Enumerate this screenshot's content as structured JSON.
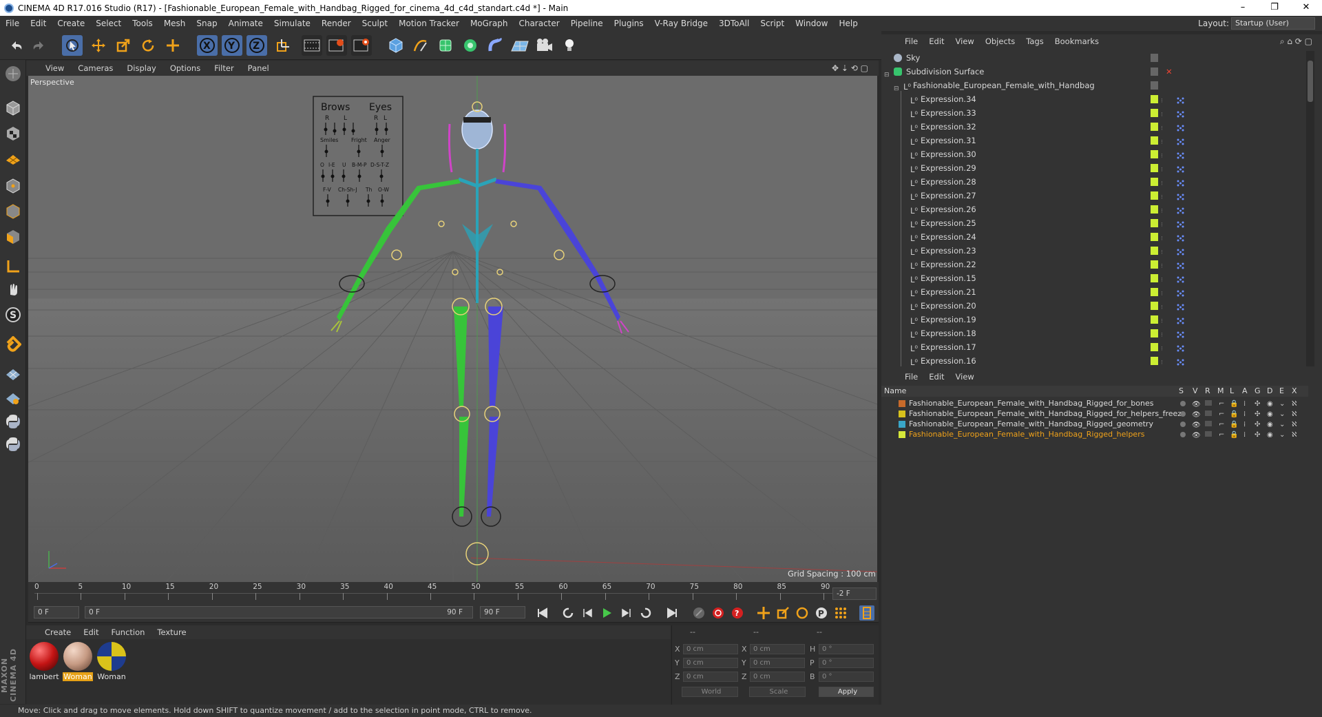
{
  "window": {
    "title": "CINEMA 4D R17.016 Studio (R17) - [Fashionable_European_Female_with_Handbag_Rigged_for_cinema_4d_c4d_standart.c4d *] - Main",
    "minimize": "–",
    "restore": "❐",
    "close": "✕"
  },
  "menubar": [
    "File",
    "Edit",
    "Create",
    "Select",
    "Tools",
    "Mesh",
    "Snap",
    "Animate",
    "Simulate",
    "Render",
    "Sculpt",
    "Motion Tracker",
    "MoGraph",
    "Character",
    "Pipeline",
    "Plugins",
    "V-Ray Bridge",
    "3DToAll",
    "Script",
    "Window",
    "Help"
  ],
  "layout": {
    "label": "Layout:",
    "value": "Startup (User)"
  },
  "viewport": {
    "menu": [
      "View",
      "Cameras",
      "Display",
      "Options",
      "Filter",
      "Panel"
    ],
    "label": "Perspective",
    "grid_spacing": "Grid Spacing : 100 cm",
    "face_panel": {
      "brows": "Brows",
      "eyes": "Eyes",
      "r1": "R",
      "l1": "L",
      "r2": "R",
      "l2": "L",
      "smiles": "Smiles",
      "fright": "Fright",
      "anger": "Anger",
      "vis": [
        "O",
        "I-E",
        "U",
        "B-M-P",
        "D-S-T-Z"
      ],
      "vis2": [
        "F-V",
        "Ch-Sh-J",
        "Th",
        "O-W"
      ]
    }
  },
  "timeline": {
    "ticks": [
      "0",
      "5",
      "10",
      "15",
      "20",
      "25",
      "30",
      "35",
      "40",
      "45",
      "50",
      "55",
      "60",
      "65",
      "70",
      "75",
      "80",
      "85",
      "90"
    ],
    "current_frame_field": "-2 F",
    "start_field": "0 F",
    "range_start": "0 F",
    "range_end": "90 F",
    "end_field": "90 F"
  },
  "materials": {
    "menu": [
      "Create",
      "Edit",
      "Function",
      "Texture"
    ],
    "items": [
      {
        "name": "lambert",
        "color": "#c41414",
        "selected": false
      },
      {
        "name": "Woman",
        "color": "#c69a83",
        "selected": true
      },
      {
        "name": "Woman",
        "color": "#d9c21a",
        "selected": false
      }
    ]
  },
  "coords": {
    "header": [
      "--",
      "--",
      "--"
    ],
    "rows": [
      {
        "a": "X",
        "av": "0 cm",
        "b": "X",
        "bv": "0 cm",
        "c": "H",
        "cv": "0 °"
      },
      {
        "a": "Y",
        "av": "0 cm",
        "b": "Y",
        "bv": "0 cm",
        "c": "P",
        "cv": "0 °"
      },
      {
        "a": "Z",
        "av": "0 cm",
        "b": "Z",
        "bv": "0 cm",
        "c": "B",
        "cv": "0 °"
      }
    ],
    "mode": "World",
    "scale": "Scale",
    "apply": "Apply"
  },
  "status": "Move: Click and drag to move elements. Hold down SHIFT to quantize movement / add to the selection in point mode, CTRL to remove.",
  "object_manager": {
    "menu": [
      "File",
      "Edit",
      "View",
      "Objects",
      "Tags",
      "Bookmarks"
    ],
    "top_items": [
      "Sky",
      "Subdivision Surface",
      "Fashionable_European_Female_with_Handbag"
    ],
    "expressions": [
      "Expression.34",
      "Expression.33",
      "Expression.32",
      "Expression.31",
      "Expression.30",
      "Expression.29",
      "Expression.28",
      "Expression.27",
      "Expression.26",
      "Expression.25",
      "Expression.24",
      "Expression.23",
      "Expression.22",
      "Expression.15",
      "Expression.21",
      "Expression.20",
      "Expression.19",
      "Expression.18",
      "Expression.17",
      "Expression.16"
    ]
  },
  "layer_manager": {
    "menu": [
      "File",
      "Edit",
      "View"
    ],
    "columns": {
      "name": "Name",
      "s": "S",
      "v": "V",
      "r": "R",
      "m": "M",
      "l": "L",
      "a": "A",
      "g": "G",
      "d": "D",
      "e": "E",
      "x": "X"
    },
    "layers": [
      {
        "name": "Fashionable_European_Female_with_Handbag_Rigged_for_bones",
        "color": "#c86a2a",
        "selected": false
      },
      {
        "name": "Fashionable_European_Female_with_Handbag_Rigged_for_helpers_freez",
        "color": "#d8c21c",
        "selected": false
      },
      {
        "name": "Fashionable_European_Female_with_Handbag_Rigged_geometry",
        "color": "#3aa6c8",
        "selected": false
      },
      {
        "name": "Fashionable_European_Female_with_Handbag_Rigged_helpers",
        "color": "#d6e83a",
        "selected": true
      }
    ]
  },
  "colors": {
    "accent": "#4a6ea8",
    "selection": "#e6a116",
    "layer_selected_text": "#f0a21a"
  }
}
